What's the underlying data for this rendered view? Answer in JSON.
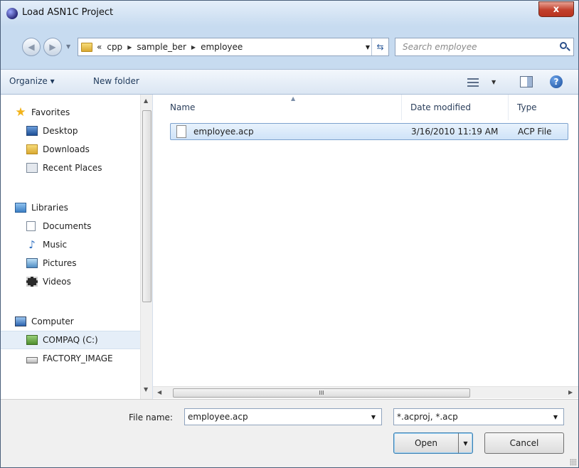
{
  "window": {
    "title": "Load ASN1C Project",
    "close_label": "x"
  },
  "navbar": {
    "back_glyph": "◀",
    "forward_glyph": "▶",
    "breadcrumb_prefix": "«",
    "breadcrumbs": [
      "cpp",
      "sample_ber",
      "employee"
    ],
    "search_placeholder": "Search employee"
  },
  "toolbar": {
    "organize": "Organize ▾",
    "new_folder": "New folder",
    "help": "?"
  },
  "nav": {
    "items": [
      {
        "label": "Favorites",
        "icon": "star-icon"
      },
      {
        "label": "Desktop",
        "icon": "desktop-icon"
      },
      {
        "label": "Downloads",
        "icon": "downloads-folder-icon"
      },
      {
        "label": "Recent Places",
        "icon": "recent-places-icon"
      },
      {
        "label": "Libraries",
        "icon": "libraries-icon"
      },
      {
        "label": "Documents",
        "icon": "documents-icon"
      },
      {
        "label": "Music",
        "icon": "music-icon"
      },
      {
        "label": "Pictures",
        "icon": "pictures-icon"
      },
      {
        "label": "Videos",
        "icon": "videos-icon"
      },
      {
        "label": "Computer",
        "icon": "computer-icon"
      },
      {
        "label": "COMPAQ (C:)",
        "icon": "drive-icon"
      },
      {
        "label": "FACTORY_IMAGE",
        "icon": "drive-icon"
      }
    ],
    "selected": "COMPAQ (C:)"
  },
  "files": {
    "columns": [
      "Name",
      "Date modified",
      "Type"
    ],
    "rows": [
      {
        "name": "employee.acp",
        "date": "3/16/2010 11:19 AM",
        "type": "ACP File"
      }
    ],
    "scroll_grip": "III"
  },
  "footer": {
    "file_name_label": "File name:",
    "file_name_value": "employee.acp",
    "filter_value": "*.acproj, *.acp",
    "open_label": "Open",
    "cancel_label": "Cancel"
  },
  "colors": {
    "accent": "#3c7fb1",
    "selection": "#cfe3f8",
    "close": "#c2402c",
    "frame": "#c4d9ee"
  }
}
